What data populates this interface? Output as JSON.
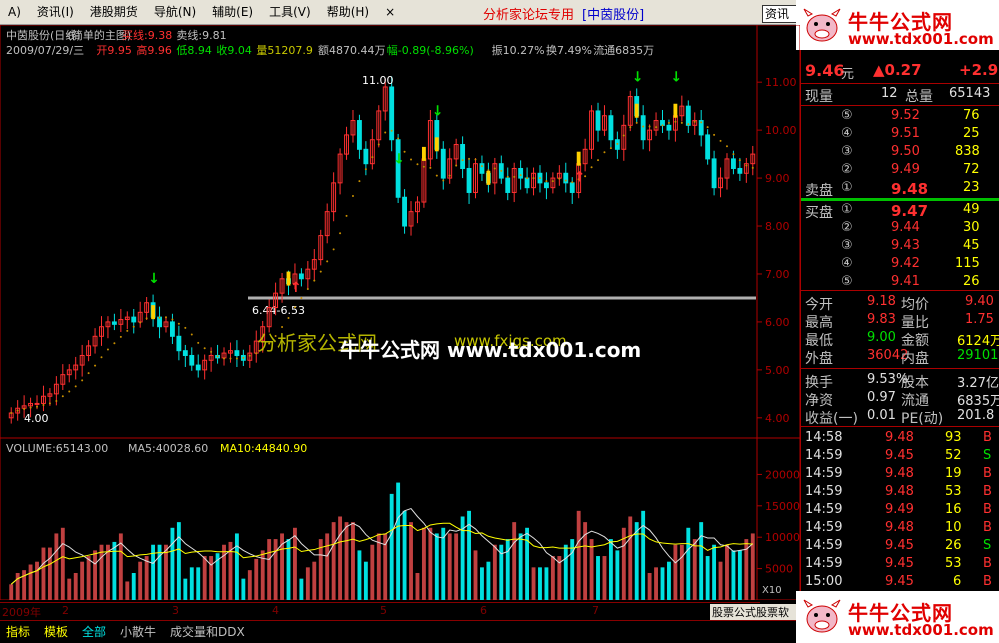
{
  "menubar": {
    "items": [
      "A)",
      "资讯(I)",
      "港股期货",
      "导航(N)",
      "辅助(E)",
      "工具(V)",
      "帮助(H)",
      "×"
    ],
    "forum_label": "分析家论坛专用",
    "forum_stock": "[中茵股份]",
    "search_label": "资讯"
  },
  "watermark": {
    "title": "牛牛公式网",
    "url": "www.tdx001.com",
    "overlay_1": "分析家公式网",
    "overlay_1b": "www.fxjgs.com",
    "overlay_2": "牛牛公式网 www.tdx001.com"
  },
  "chart_header": {
    "line1_name": "中茵股份(日线)",
    "line1_main": "(简单的主图)",
    "buy_line": "买线:9.38",
    "sell_line": "卖线:9.81",
    "date": "2009/07/29/三",
    "open": "开9.95",
    "high": "高9.96",
    "low": "低8.94",
    "close": "收9.04",
    "vol": "量51207.9",
    "amount": "额4870.44万",
    "change": "幅-0.89(-8.96%)",
    "amplitude": "振10.27%",
    "turnover": "换7.49%",
    "float": "流通6835万",
    "peak_label": "11.00",
    "low_label": "4.00",
    "gap_label": "6.44-6.53"
  },
  "volume_header": {
    "vol": "VOLUME:65143.00",
    "ma5": "MA5:40028.60",
    "ma10": "MA10:44840.90"
  },
  "chart_data": {
    "type": "candlestick",
    "price_axis": {
      "ticks": [
        4.0,
        5.0,
        6.0,
        7.0,
        8.0,
        9.0,
        10.0,
        11.0
      ],
      "labels": [
        "4.00",
        "5.00",
        "6.00",
        "7.00",
        "8.00",
        "9.00",
        "10.00",
        "11.00"
      ],
      "range": [
        3.6,
        11.4
      ]
    },
    "volume_axis": {
      "ticks": [
        5000,
        10000,
        15000,
        20000
      ],
      "labels": [
        "5000",
        "10000",
        "15000",
        "20000"
      ],
      "range": [
        0,
        21500
      ]
    },
    "month_labels": [
      "2009年",
      "2",
      "3",
      "4",
      "5",
      "6",
      "7"
    ],
    "close": [
      4.1,
      4.2,
      4.25,
      4.3,
      4.3,
      4.45,
      4.5,
      4.7,
      4.9,
      5.0,
      5.1,
      5.3,
      5.5,
      5.7,
      5.9,
      6.0,
      5.95,
      6.05,
      6.1,
      6.0,
      6.2,
      6.4,
      6.1,
      5.9,
      6.0,
      5.7,
      5.4,
      5.3,
      5.1,
      5.0,
      5.2,
      5.3,
      5.25,
      5.35,
      5.4,
      5.3,
      5.2,
      5.35,
      5.6,
      5.9,
      6.3,
      6.6,
      6.9,
      6.8,
      7.0,
      6.9,
      7.1,
      7.3,
      7.8,
      8.3,
      8.9,
      9.5,
      9.9,
      10.2,
      9.6,
      9.3,
      9.8,
      10.4,
      10.9,
      9.8,
      8.6,
      8.0,
      8.3,
      8.5,
      9.4,
      10.2,
      9.6,
      9.0,
      9.4,
      9.7,
      9.2,
      8.7,
      9.3,
      9.1,
      8.9,
      9.3,
      9.0,
      8.7,
      9.2,
      9.0,
      8.8,
      9.1,
      8.9,
      8.8,
      9.0,
      9.1,
      8.9,
      8.7,
      9.3,
      9.6,
      10.4,
      10.0,
      10.3,
      9.8,
      9.6,
      10.1,
      10.7,
      10.3,
      9.8,
      10.0,
      10.2,
      10.1,
      10.0,
      10.3,
      10.5,
      10.1,
      10.2,
      9.9,
      9.4,
      8.8,
      9.0,
      9.4,
      9.2,
      9.1,
      9.3,
      9.5
    ],
    "buy_line_value": 9.38,
    "sell_line_value": 9.81,
    "support_level": 6.5,
    "latest_volume": 65143.0,
    "ma5": 40028.6,
    "ma10": 44840.9
  },
  "quote": {
    "price": "9.46",
    "price_unit": "元",
    "change": "▲0.27",
    "change_pct": "+2.9",
    "now_vol_label": "现量",
    "now_vol": "12",
    "total_vol_label": "总量",
    "total_vol": "65143",
    "sell_label": "卖盘",
    "buy_label": "买盘",
    "asks": [
      {
        "lvl": "⑤",
        "price": "9.52",
        "vol": "76"
      },
      {
        "lvl": "④",
        "price": "9.51",
        "vol": "25"
      },
      {
        "lvl": "③",
        "price": "9.50",
        "vol": "838"
      },
      {
        "lvl": "②",
        "price": "9.49",
        "vol": "72"
      },
      {
        "lvl": "①",
        "price": "9.48",
        "vol": "23"
      }
    ],
    "bids": [
      {
        "lvl": "①",
        "price": "9.47",
        "vol": "49"
      },
      {
        "lvl": "②",
        "price": "9.44",
        "vol": "30"
      },
      {
        "lvl": "③",
        "price": "9.43",
        "vol": "45"
      },
      {
        "lvl": "④",
        "price": "9.42",
        "vol": "115"
      },
      {
        "lvl": "⑤",
        "price": "9.41",
        "vol": "26"
      }
    ],
    "stats": [
      {
        "k1": "今开",
        "v1": "9.18",
        "k2": "均价",
        "v2": "9.40"
      },
      {
        "k1": "最高",
        "v1": "9.83",
        "k2": "量比",
        "v2": "1.75"
      },
      {
        "k1": "最低",
        "v1": "9.00",
        "k2": "金额",
        "v2": "6124万"
      },
      {
        "k1": "外盘",
        "v1": "36042",
        "k2": "内盘",
        "v2": "29101"
      }
    ],
    "fund": [
      {
        "k1": "换手",
        "v1": "9.53%",
        "k2": "股本",
        "v2": "3.27亿"
      },
      {
        "k1": "净资",
        "v1": "0.97",
        "k2": "流通",
        "v2": "6835万"
      },
      {
        "k1": "收益(一)",
        "v1": "0.01",
        "k2": "PE(动)",
        "v2": "201.8"
      }
    ],
    "ticks": [
      {
        "t": "14:58",
        "p": "9.48",
        "v": "93",
        "s": "B"
      },
      {
        "t": "14:59",
        "p": "9.45",
        "v": "52",
        "s": "S"
      },
      {
        "t": "14:59",
        "p": "9.48",
        "v": "19",
        "s": "B"
      },
      {
        "t": "14:59",
        "p": "9.48",
        "v": "53",
        "s": "B"
      },
      {
        "t": "14:59",
        "p": "9.49",
        "v": "16",
        "s": "B"
      },
      {
        "t": "14:59",
        "p": "9.48",
        "v": "10",
        "s": "B"
      },
      {
        "t": "14:59",
        "p": "9.45",
        "v": "26",
        "s": "S"
      },
      {
        "t": "14:59",
        "p": "9.45",
        "v": "53",
        "s": "B"
      },
      {
        "t": "15:00",
        "p": "9.45",
        "v": "6",
        "s": "B"
      }
    ]
  },
  "bottom_tabs": [
    "指标",
    "模板",
    "全部",
    "小散牛",
    "成交量和DDX"
  ],
  "scroll_label": "股票公式股票软",
  "x10": "X10",
  "colors": {
    "up": "#ff3030",
    "down": "#00e0e0",
    "buy": "#ffd000",
    "ma": "#ffff00",
    "bg": "#000000",
    "axis": "#b00000"
  }
}
